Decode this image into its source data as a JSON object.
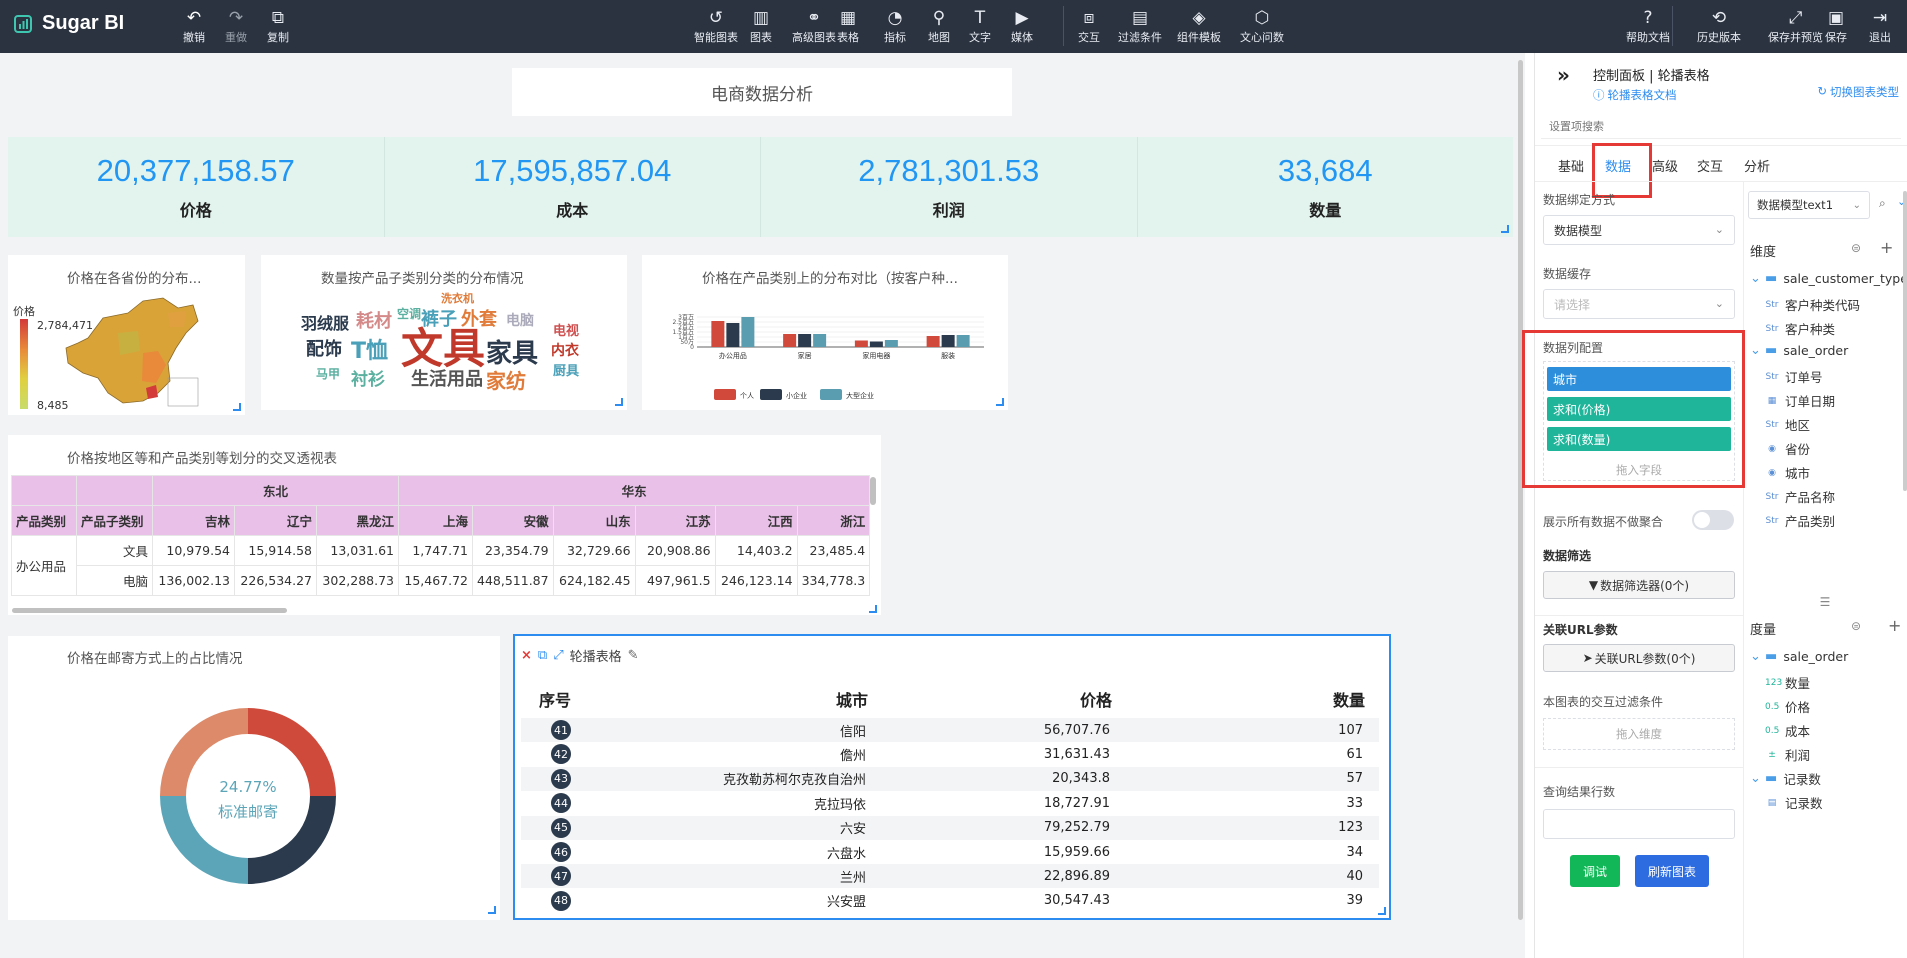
{
  "app": {
    "logo_text": "Sugar BI"
  },
  "toolbar_left": [
    {
      "id": "undo",
      "label": "撤销",
      "icon": "undo-icon"
    },
    {
      "id": "redo",
      "label": "重做",
      "icon": "redo-icon"
    },
    {
      "id": "copy",
      "label": "复制",
      "icon": "copy-icon"
    }
  ],
  "toolbar_center": [
    {
      "id": "smart-chart",
      "label": "智能图表",
      "icon": "smart-chart-icon"
    },
    {
      "id": "chart",
      "label": "图表",
      "icon": "bar-chart-icon"
    },
    {
      "id": "adv-chart",
      "label": "高级图表",
      "icon": "advanced-chart-icon"
    },
    {
      "id": "table",
      "label": "表格",
      "icon": "table-icon"
    },
    {
      "id": "indicator",
      "label": "指标",
      "icon": "gauge-icon"
    },
    {
      "id": "map",
      "label": "地图",
      "icon": "map-pin-icon"
    },
    {
      "id": "text",
      "label": "文字",
      "icon": "text-icon"
    },
    {
      "id": "media",
      "label": "媒体",
      "icon": "media-icon"
    },
    {
      "id": "interaction",
      "label": "交互",
      "icon": "interaction-icon"
    },
    {
      "id": "filter",
      "label": "过滤条件",
      "icon": "filter-icon"
    },
    {
      "id": "template",
      "label": "组件模板",
      "icon": "template-icon"
    },
    {
      "id": "wenxin",
      "label": "文心问数",
      "icon": "wenxin-icon"
    }
  ],
  "toolbar_right": [
    {
      "id": "help",
      "label": "帮助文档",
      "icon": "help-icon"
    },
    {
      "id": "history",
      "label": "历史版本",
      "icon": "history-icon"
    },
    {
      "id": "save-preview",
      "label": "保存并预览",
      "icon": "expand-icon"
    },
    {
      "id": "save",
      "label": "保存",
      "icon": "save-icon"
    },
    {
      "id": "exit",
      "label": "退出",
      "icon": "exit-icon"
    }
  ],
  "dashboard": {
    "title": "电商数据分析",
    "kpis": [
      {
        "value": "20,377,158.57",
        "label": "价格"
      },
      {
        "value": "17,595,857.04",
        "label": "成本"
      },
      {
        "value": "2,781,301.53",
        "label": "利润"
      },
      {
        "value": "33,684",
        "label": "数量"
      }
    ],
    "map_chart": {
      "title": "价格在各省份的分布...",
      "legend_label": "价格",
      "max": "2,784,471",
      "min": "8,485"
    },
    "wordcloud": {
      "title": "数量按产品子类别分类的分布情况",
      "words": [
        {
          "text": "文具",
          "color": "#c0392b"
        },
        {
          "text": "家具",
          "color": "#2b3a4d"
        },
        {
          "text": "生活用品",
          "color": "#555"
        },
        {
          "text": "家纺",
          "color": "#e07b39"
        },
        {
          "text": "T恤",
          "color": "#4aa0b8"
        },
        {
          "text": "配饰",
          "color": "#2b3a4d"
        },
        {
          "text": "羽绒服",
          "color": "#2b3a4d"
        },
        {
          "text": "耗材",
          "color": "#d58a8a"
        },
        {
          "text": "空调",
          "color": "#5bb0a0"
        },
        {
          "text": "裤子",
          "color": "#4aa0b8"
        },
        {
          "text": "外套",
          "color": "#e07b39"
        },
        {
          "text": "洗衣机",
          "color": "#e07b39"
        },
        {
          "text": "电脑",
          "color": "#aab"
        },
        {
          "text": "电视",
          "color": "#d05050"
        },
        {
          "text": "内衣",
          "color": "#c0392b"
        },
        {
          "text": "厨具",
          "color": "#4aa0b8"
        },
        {
          "text": "衬衫",
          "color": "#5bb0a0"
        },
        {
          "text": "马甲",
          "color": "#5bb0a0"
        }
      ]
    },
    "pivot": {
      "title": "价格按地区等和产品类别等划分的交叉透视表",
      "regions": [
        "东北",
        "华东"
      ],
      "row_headers": [
        "产品类别",
        "产品子类别"
      ],
      "cities": [
        "吉林",
        "辽宁",
        "黑龙江",
        "上海",
        "安徽",
        "山东",
        "江苏",
        "江西",
        "浙江"
      ],
      "category": "办公用品",
      "rows": [
        {
          "sub": "文具",
          "values": [
            "10,979.54",
            "15,914.58",
            "13,031.61",
            "1,747.71",
            "23,354.79",
            "32,729.66",
            "20,908.86",
            "14,403.2",
            "23,485.4"
          ]
        },
        {
          "sub": "电脑",
          "values": [
            "136,002.13",
            "226,534.27",
            "302,288.73",
            "15,467.72",
            "448,511.87",
            "624,182.45",
            "497,961.5",
            "246,123.14",
            "334,778.3"
          ]
        }
      ]
    },
    "donut": {
      "title": "价格在邮寄方式上的占比情况",
      "center_pct": "24.77%",
      "center_label": "标准邮寄"
    },
    "carousel": {
      "title": "轮播表格",
      "headers": [
        "序号",
        "城市",
        "价格",
        "数量"
      ],
      "rows": [
        {
          "n": "41",
          "city": "信阳",
          "price": "56,707.76",
          "qty": "107"
        },
        {
          "n": "42",
          "city": "儋州",
          "price": "31,631.43",
          "qty": "61"
        },
        {
          "n": "43",
          "city": "克孜勒苏柯尔克孜自治州",
          "price": "20,343.8",
          "qty": "57"
        },
        {
          "n": "44",
          "city": "克拉玛依",
          "price": "18,727.91",
          "qty": "33"
        },
        {
          "n": "45",
          "city": "六安",
          "price": "79,252.79",
          "qty": "123"
        },
        {
          "n": "46",
          "city": "六盘水",
          "price": "15,959.66",
          "qty": "34"
        },
        {
          "n": "47",
          "city": "兰州",
          "price": "22,896.89",
          "qty": "40"
        },
        {
          "n": "48",
          "city": "兴安盟",
          "price": "30,547.43",
          "qty": "39"
        }
      ]
    }
  },
  "chart_data": {
    "type": "bar",
    "title": "价格在产品类别上的分布对比（按客户种...",
    "categories": [
      "办公用品",
      "家居",
      "家用电器",
      "服装"
    ],
    "series": [
      {
        "name": "个人",
        "color": "#d0493a",
        "values": [
          2.6,
          1.3,
          0.65,
          1.1
        ]
      },
      {
        "name": "小企业",
        "color": "#2b3a4d",
        "values": [
          2.4,
          1.3,
          0.55,
          1.2
        ]
      },
      {
        "name": "大型企业",
        "color": "#5b9db0",
        "values": [
          3.0,
          1.3,
          0.7,
          1.2
        ]
      }
    ],
    "yticks": [
      "3百万",
      "2.5百万",
      "2百万",
      "1.5百万",
      "1百万",
      "50万",
      "0"
    ],
    "ylim": [
      0,
      3
    ],
    "legend": "bottom"
  },
  "side_panel": {
    "header_title": "控制面板 | 轮播表格",
    "doc_link": "轮播表格文档",
    "switch_label": "切换图表类型",
    "search_placeholder": "设置项搜索",
    "tabs": [
      "基础",
      "数据",
      "高级",
      "交互",
      "分析"
    ],
    "bind_label": "数据绑定方式",
    "bind_value": "数据模型",
    "cache_label": "数据缓存",
    "cache_placeholder": "请选择",
    "columns_label": "数据列配置",
    "columns": [
      {
        "label": "城市",
        "color": "#2d8fdc"
      },
      {
        "label": "求和(价格)",
        "color": "#1fb59a"
      },
      {
        "label": "求和(数量)",
        "color": "#1fb59a"
      }
    ],
    "drag_field": "拖入字段",
    "show_all_label": "展示所有数据不做聚合",
    "filter_label": "数据筛选",
    "filter_btn": "数据筛选器(0个)",
    "url_label": "关联URL参数",
    "url_btn": "关联URL参数(0个)",
    "interact_label": "本图表的交互过滤条件",
    "drag_dim": "拖入维度",
    "rows_label": "查询结果行数",
    "debug_btn": "调试",
    "refresh_btn": "刷新图表",
    "model_select": "数据模型text1",
    "dim_label": "维度",
    "dims": [
      {
        "label": "sale_customer_type",
        "type": "folder"
      },
      {
        "label": "客户种类代码",
        "type": "str"
      },
      {
        "label": "客户种类",
        "type": "str"
      },
      {
        "label": "sale_order",
        "type": "folder"
      },
      {
        "label": "订单号",
        "type": "str"
      },
      {
        "label": "订单日期",
        "type": "date"
      },
      {
        "label": "地区",
        "type": "str"
      },
      {
        "label": "省份",
        "type": "geo"
      },
      {
        "label": "城市",
        "type": "geo"
      },
      {
        "label": "产品名称",
        "type": "str"
      },
      {
        "label": "产品类别",
        "type": "str"
      }
    ],
    "measure_label": "度量",
    "measures": [
      {
        "label": "sale_order",
        "type": "folder"
      },
      {
        "label": "数量",
        "type": "123"
      },
      {
        "label": "价格",
        "type": "0.5"
      },
      {
        "label": "成本",
        "type": "0.5"
      },
      {
        "label": "利润",
        "type": "calc"
      },
      {
        "label": "记录数",
        "type": "folder"
      },
      {
        "label": "记录数",
        "type": "rec"
      }
    ]
  }
}
